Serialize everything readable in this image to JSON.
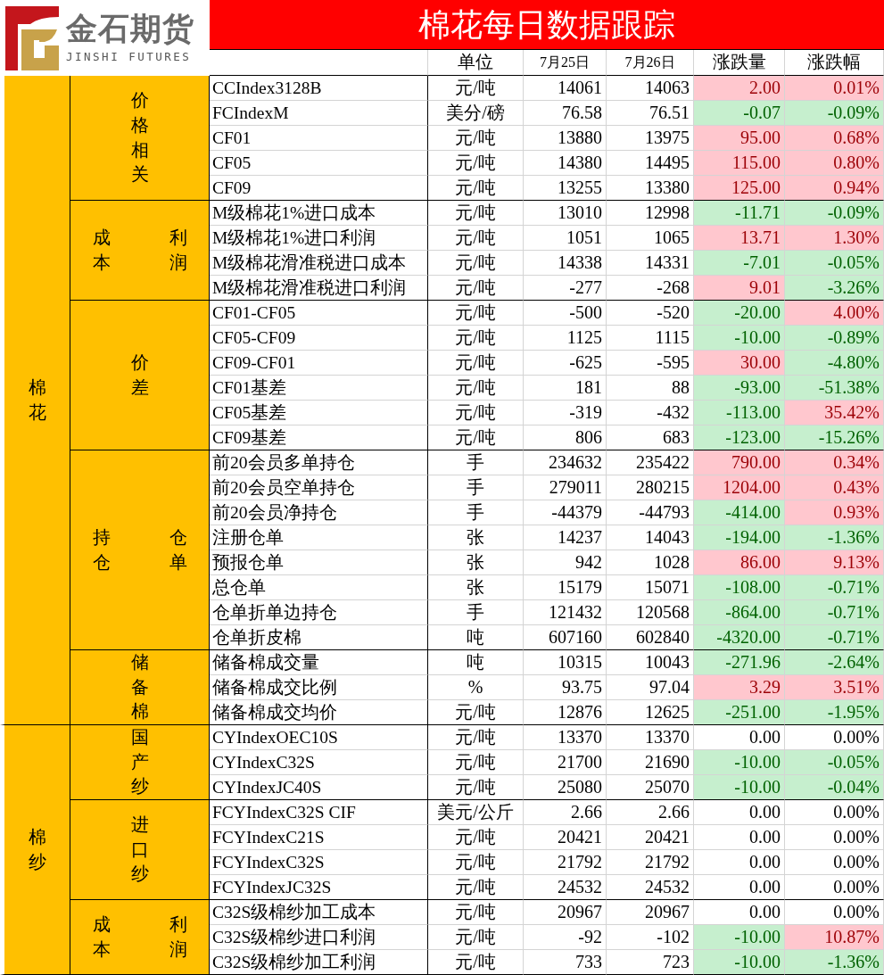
{
  "logo": {
    "name": "金石期货",
    "tagline": "JINSHI FUTURES"
  },
  "title": "棉花每日数据跟踪",
  "columns": [
    "单位",
    "7月25日",
    "7月26日",
    "涨跌量",
    "涨跌幅"
  ],
  "groups": [
    {
      "category": "棉花",
      "subgroups": [
        {
          "kind": "vertical",
          "label": "价格相关",
          "rows": [
            {
              "name": "CCIndex3128B",
              "unit": "元/吨",
              "day1": "14061",
              "day2": "14063",
              "change": {
                "text": "2.00",
                "color": "#ffc7ce"
              },
              "pct": {
                "text": "0.01%",
                "color": "#ffc7ce"
              }
            },
            {
              "name": "FCIndexM",
              "unit": "美分/磅",
              "day1": "76.58",
              "day2": "76.51",
              "change": {
                "text": "-0.07",
                "color": "#c6efce"
              },
              "pct": {
                "text": "-0.09%",
                "color": "#c6efce"
              }
            },
            {
              "name": "CF01",
              "unit": "元/吨",
              "day1": "13880",
              "day2": "13975",
              "change": {
                "text": "95.00",
                "color": "#ffc7ce"
              },
              "pct": {
                "text": "0.68%",
                "color": "#ffc7ce"
              }
            },
            {
              "name": "CF05",
              "unit": "元/吨",
              "day1": "14380",
              "day2": "14495",
              "change": {
                "text": "115.00",
                "color": "#ffc7ce"
              },
              "pct": {
                "text": "0.80%",
                "color": "#ffc7ce"
              }
            },
            {
              "name": "CF09",
              "unit": "元/吨",
              "day1": "13255",
              "day2": "13380",
              "change": {
                "text": "125.00",
                "color": "#ffc7ce"
              },
              "pct": {
                "text": "0.94%",
                "color": "#ffc7ce"
              }
            }
          ]
        },
        {
          "kind": "columns",
          "label_columns": [
            "成本",
            "利润"
          ],
          "rows": [
            {
              "name": "M级棉花1%进口成本",
              "unit": "元/吨",
              "day1": "13010",
              "day2": "12998",
              "change": {
                "text": "-11.71",
                "color": "#c6efce"
              },
              "pct": {
                "text": "-0.09%",
                "color": "#c6efce"
              }
            },
            {
              "name": "M级棉花1%进口利润",
              "unit": "元/吨",
              "day1": "1051",
              "day2": "1065",
              "change": {
                "text": "13.71",
                "color": "#ffc7ce"
              },
              "pct": {
                "text": "1.30%",
                "color": "#ffc7ce"
              }
            },
            {
              "name": "M级棉花滑准税进口成本",
              "unit": "元/吨",
              "day1": "14338",
              "day2": "14331",
              "change": {
                "text": "-7.01",
                "color": "#c6efce"
              },
              "pct": {
                "text": "-0.05%",
                "color": "#c6efce"
              }
            },
            {
              "name": "M级棉花滑准税进口利润",
              "unit": "元/吨",
              "day1": "-277",
              "day2": "-268",
              "change": {
                "text": "9.01",
                "color": "#ffc7ce"
              },
              "pct": {
                "text": "-3.26%",
                "color": "#c6efce"
              }
            }
          ]
        },
        {
          "kind": "vertical",
          "label": "价差",
          "rows": [
            {
              "name": "CF01-CF05",
              "unit": "元/吨",
              "day1": "-500",
              "day2": "-520",
              "change": {
                "text": "-20.00",
                "color": "#c6efce"
              },
              "pct": {
                "text": "4.00%",
                "color": "#ffc7ce"
              }
            },
            {
              "name": "CF05-CF09",
              "unit": "元/吨",
              "day1": "1125",
              "day2": "1115",
              "change": {
                "text": "-10.00",
                "color": "#c6efce"
              },
              "pct": {
                "text": "-0.89%",
                "color": "#c6efce"
              }
            },
            {
              "name": "CF09-CF01",
              "unit": "元/吨",
              "day1": "-625",
              "day2": "-595",
              "change": {
                "text": "30.00",
                "color": "#ffc7ce"
              },
              "pct": {
                "text": "-4.80%",
                "color": "#c6efce"
              }
            },
            {
              "name": "CF01基差",
              "unit": "元/吨",
              "day1": "181",
              "day2": "88",
              "change": {
                "text": "-93.00",
                "color": "#c6efce"
              },
              "pct": {
                "text": "-51.38%",
                "color": "#c6efce"
              }
            },
            {
              "name": "CF05基差",
              "unit": "元/吨",
              "day1": "-319",
              "day2": "-432",
              "change": {
                "text": "-113.00",
                "color": "#c6efce"
              },
              "pct": {
                "text": "35.42%",
                "color": "#ffc7ce"
              }
            },
            {
              "name": "CF09基差",
              "unit": "元/吨",
              "day1": "806",
              "day2": "683",
              "change": {
                "text": "-123.00",
                "color": "#c6efce"
              },
              "pct": {
                "text": "-15.26%",
                "color": "#c6efce"
              }
            }
          ]
        },
        {
          "kind": "columns",
          "label_columns": [
            "持仓",
            "仓单"
          ],
          "rows": [
            {
              "name": "前20会员多单持仓",
              "unit": "手",
              "day1": "234632",
              "day2": "235422",
              "change": {
                "text": "790.00",
                "color": "#ffc7ce"
              },
              "pct": {
                "text": "0.34%",
                "color": "#ffc7ce"
              }
            },
            {
              "name": "前20会员空单持仓",
              "unit": "手",
              "day1": "279011",
              "day2": "280215",
              "change": {
                "text": "1204.00",
                "color": "#ffc7ce"
              },
              "pct": {
                "text": "0.43%",
                "color": "#ffc7ce"
              }
            },
            {
              "name": "前20会员净持仓",
              "unit": "手",
              "day1": "-44379",
              "day2": "-44793",
              "change": {
                "text": "-414.00",
                "color": "#c6efce"
              },
              "pct": {
                "text": "0.93%",
                "color": "#ffc7ce"
              }
            },
            {
              "name": "注册仓单",
              "unit": "张",
              "day1": "14237",
              "day2": "14043",
              "change": {
                "text": "-194.00",
                "color": "#c6efce"
              },
              "pct": {
                "text": "-1.36%",
                "color": "#c6efce"
              }
            },
            {
              "name": "预报仓单",
              "unit": "张",
              "day1": "942",
              "day2": "1028",
              "change": {
                "text": "86.00",
                "color": "#ffc7ce"
              },
              "pct": {
                "text": "9.13%",
                "color": "#ffc7ce"
              }
            },
            {
              "name": "总仓单",
              "unit": "张",
              "day1": "15179",
              "day2": "15071",
              "change": {
                "text": "-108.00",
                "color": "#c6efce"
              },
              "pct": {
                "text": "-0.71%",
                "color": "#c6efce"
              }
            },
            {
              "name": "仓单折单边持仓",
              "unit": "手",
              "day1": "121432",
              "day2": "120568",
              "change": {
                "text": "-864.00",
                "color": "#c6efce"
              },
              "pct": {
                "text": "-0.71%",
                "color": "#c6efce"
              }
            },
            {
              "name": "仓单折皮棉",
              "unit": "吨",
              "day1": "607160",
              "day2": "602840",
              "change": {
                "text": "-4320.00",
                "color": "#c6efce"
              },
              "pct": {
                "text": "-0.71%",
                "color": "#c6efce"
              }
            }
          ]
        },
        {
          "kind": "vertical",
          "label": "储备棉",
          "rows": [
            {
              "name": "储备棉成交量",
              "unit": "吨",
              "day1": "10315",
              "day2": "10043",
              "change": {
                "text": "-271.96",
                "color": "#c6efce"
              },
              "pct": {
                "text": "-2.64%",
                "color": "#c6efce"
              }
            },
            {
              "name": "储备棉成交比例",
              "unit": "%",
              "day1": "93.75",
              "day2": "97.04",
              "change": {
                "text": "3.29",
                "color": "#ffc7ce"
              },
              "pct": {
                "text": "3.51%",
                "color": "#ffc7ce"
              }
            },
            {
              "name": "储备棉成交均价",
              "unit": "元/吨",
              "day1": "12876",
              "day2": "12625",
              "change": {
                "text": "-251.00",
                "color": "#c6efce"
              },
              "pct": {
                "text": "-1.95%",
                "color": "#c6efce"
              }
            }
          ]
        }
      ]
    },
    {
      "category": "棉纱",
      "subgroups": [
        {
          "kind": "vertical",
          "label": "国产纱",
          "rows": [
            {
              "name": "CYIndexOEC10S",
              "unit": "元/吨",
              "day1": "13370",
              "day2": "13370",
              "change": {
                "text": "0.00"
              },
              "pct": {
                "text": "0.00%"
              }
            },
            {
              "name": "CYIndexC32S",
              "unit": "元/吨",
              "day1": "21700",
              "day2": "21690",
              "change": {
                "text": "-10.00",
                "color": "#c6efce"
              },
              "pct": {
                "text": "-0.05%",
                "color": "#c6efce"
              }
            },
            {
              "name": "CYIndexJC40S",
              "unit": "元/吨",
              "day1": "25080",
              "day2": "25070",
              "change": {
                "text": "-10.00",
                "color": "#c6efce"
              },
              "pct": {
                "text": "-0.04%",
                "color": "#c6efce"
              }
            }
          ]
        },
        {
          "kind": "vertical",
          "label": "进口纱",
          "rows": [
            {
              "name": "FCYIndexC32S CIF",
              "unit": "美元/公斤",
              "day1": "2.66",
              "day2": "2.66",
              "change": {
                "text": "0.00"
              },
              "pct": {
                "text": "0.00%"
              }
            },
            {
              "name": "FCYIndexC21S",
              "unit": "元/吨",
              "day1": "20421",
              "day2": "20421",
              "change": {
                "text": "0.00"
              },
              "pct": {
                "text": "0.00%"
              }
            },
            {
              "name": "FCYIndexC32S",
              "unit": "元/吨",
              "day1": "21792",
              "day2": "21792",
              "change": {
                "text": "0.00"
              },
              "pct": {
                "text": "0.00%"
              }
            },
            {
              "name": "FCYIndexJC32S",
              "unit": "元/吨",
              "day1": "24532",
              "day2": "24532",
              "change": {
                "text": "0.00"
              },
              "pct": {
                "text": "0.00%"
              }
            }
          ]
        },
        {
          "kind": "columns",
          "label_columns": [
            "成本",
            "利润"
          ],
          "rows": [
            {
              "name": "C32S级棉纱加工成本",
              "unit": "元/吨",
              "day1": "20967",
              "day2": "20967",
              "change": {
                "text": "0.00"
              },
              "pct": {
                "text": "0.00%"
              }
            },
            {
              "name": "C32S级棉纱进口利润",
              "unit": "元/吨",
              "day1": "-92",
              "day2": "-102",
              "change": {
                "text": "-10.00",
                "color": "#c6efce"
              },
              "pct": {
                "text": "10.87%",
                "color": "#ffc7ce"
              }
            },
            {
              "name": "C32S级棉纱加工利润",
              "unit": "元/吨",
              "day1": "733",
              "day2": "723",
              "change": {
                "text": "-10.00",
                "color": "#c6efce"
              },
              "pct": {
                "text": "-1.36%",
                "color": "#c6efce"
              }
            }
          ]
        }
      ]
    }
  ]
}
